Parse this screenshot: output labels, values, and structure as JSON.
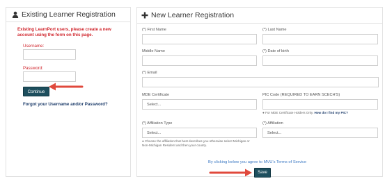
{
  "existing": {
    "title": "Existing Learner Registration",
    "warning": "Existing LearnPort users, please create a new account using the form on this page.",
    "username_label": "Username:",
    "password_label": "Password:",
    "continue_label": "Continue",
    "forgot_label": "Forgot your Username and/or Password?"
  },
  "new": {
    "title": "New Learner Registration",
    "first_name_label": "(*) First Name",
    "last_name_label": "(*) Last Name",
    "middle_name_label": "Middle Name",
    "dob_label": "(*) Date of birth",
    "email_label": "(*) Email",
    "mde_label": "MDE Certificate",
    "mde_placeholder": "Select...",
    "pic_label": "PIC Code (REQUIRED TO EARN SCECH'S)",
    "pic_note": "For MDE Certificate Holders Only.",
    "pic_link": "How do I find my PIC?",
    "aff_type_label": "(*) Affiliation Type",
    "aff_type_placeholder": "Select...",
    "aff_label": "(*) Affiliation",
    "aff_placeholder": "Select...",
    "aff_note": "Choose the affiliation that best describes you otherwise select Michigan or Non-Michigan Resident and then your county.",
    "terms": "By clicking below you agree to MVU's Terms of Service",
    "save_label": "Save"
  },
  "colors": {
    "button": "#1e4f5e",
    "warning": "#d0242b",
    "link": "#3b78c3",
    "arrow": "#e0493c"
  },
  "icons": {
    "existing_header": "user-icon",
    "new_header": "plus-icon"
  }
}
